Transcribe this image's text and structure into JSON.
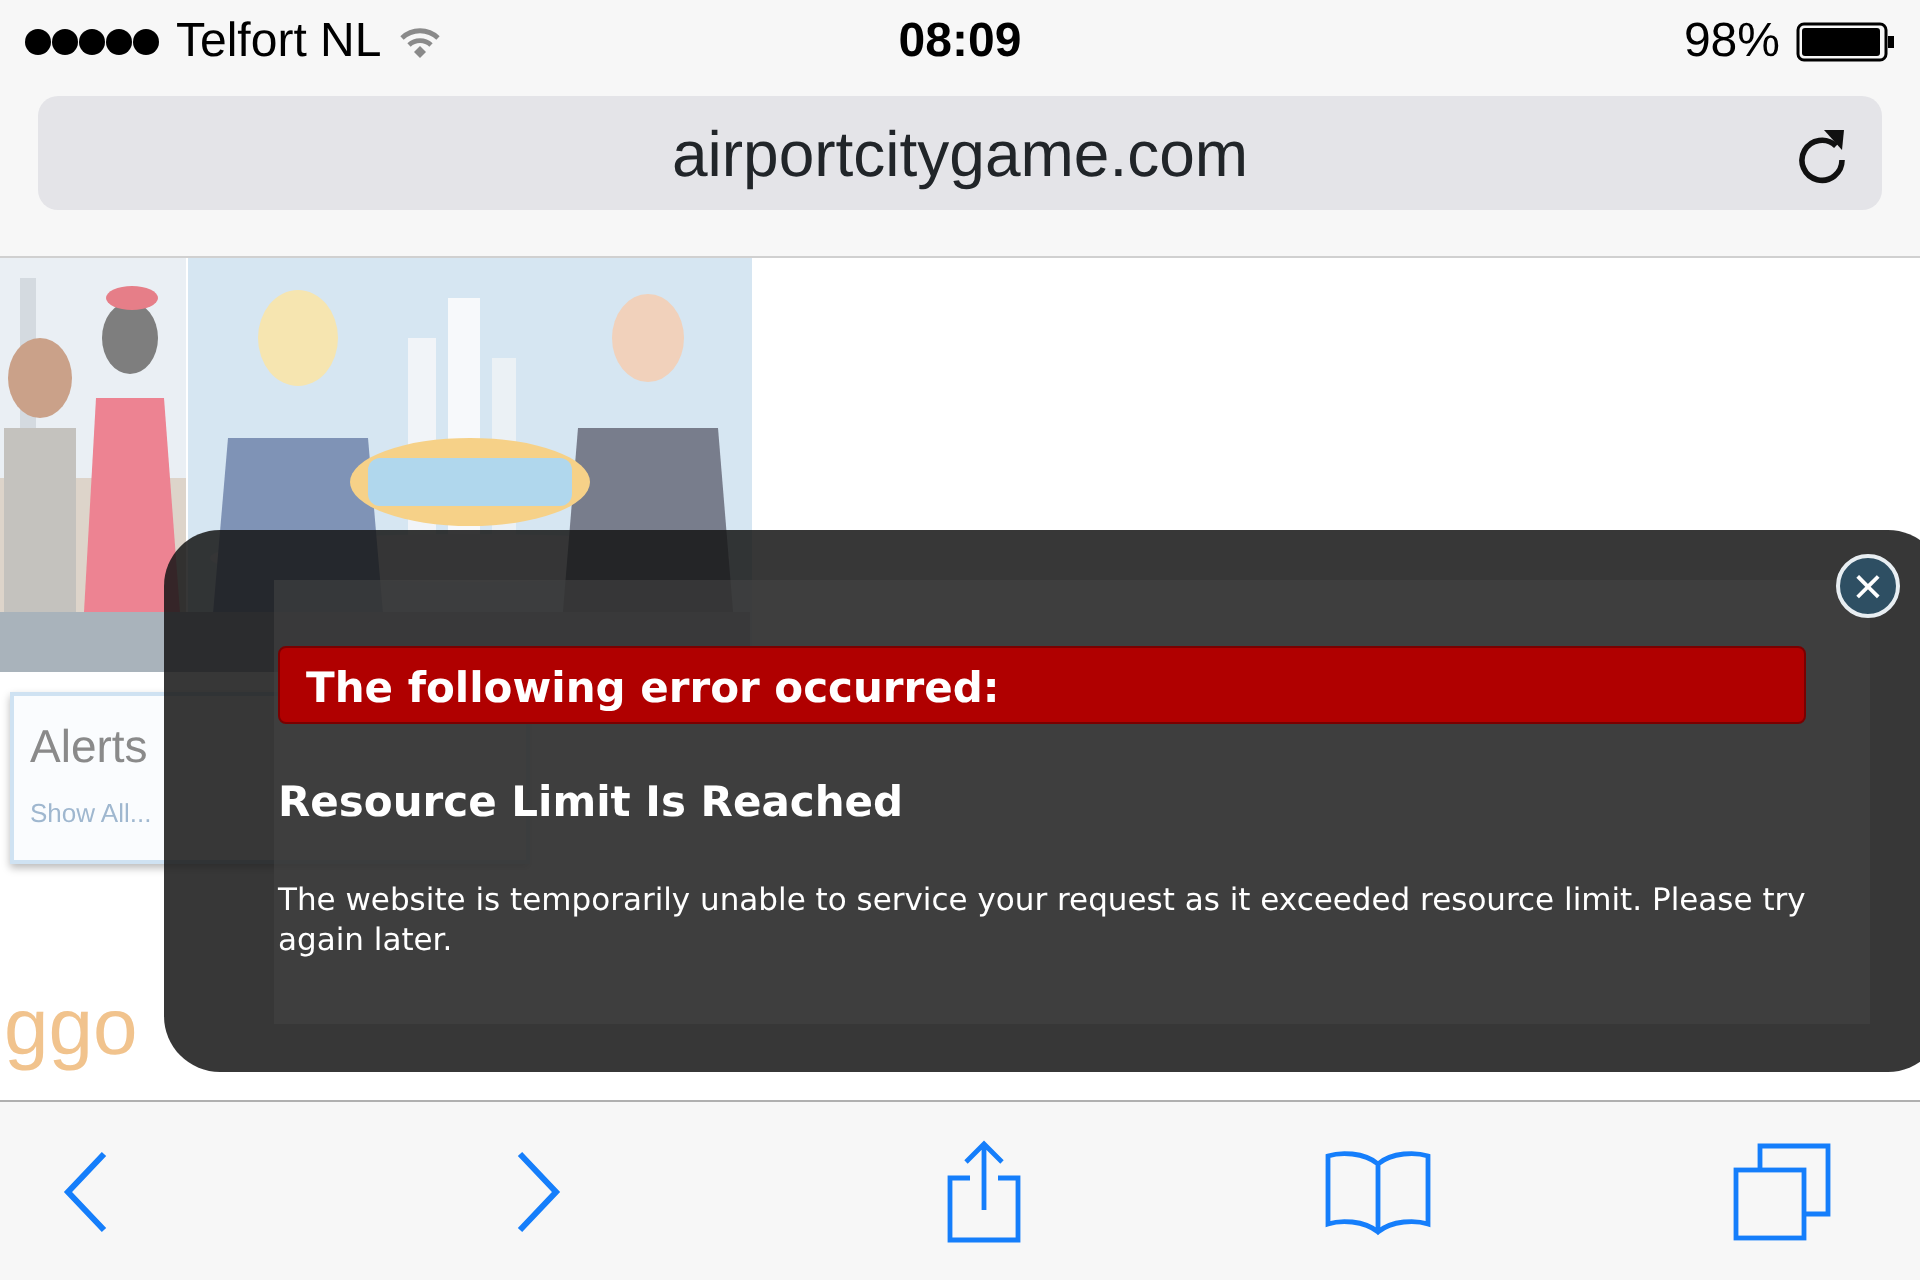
{
  "status_bar": {
    "carrier": "Telfort NL",
    "time": "08:09",
    "battery": "98%"
  },
  "address_bar": {
    "url": "airportcitygame.com"
  },
  "page": {
    "alerts_popup": {
      "title": "Alerts",
      "link": "Show All..."
    },
    "logo_fragment": "ggo"
  },
  "error_dialog": {
    "banner": "The following error occurred:",
    "heading": "Resource Limit Is Reached",
    "message": "The website is temporarily unable to service your request as it exceeded resource limit. Please try again later.",
    "close": "×"
  },
  "toolbar": {
    "back_disabled": false,
    "forward_disabled": false
  }
}
